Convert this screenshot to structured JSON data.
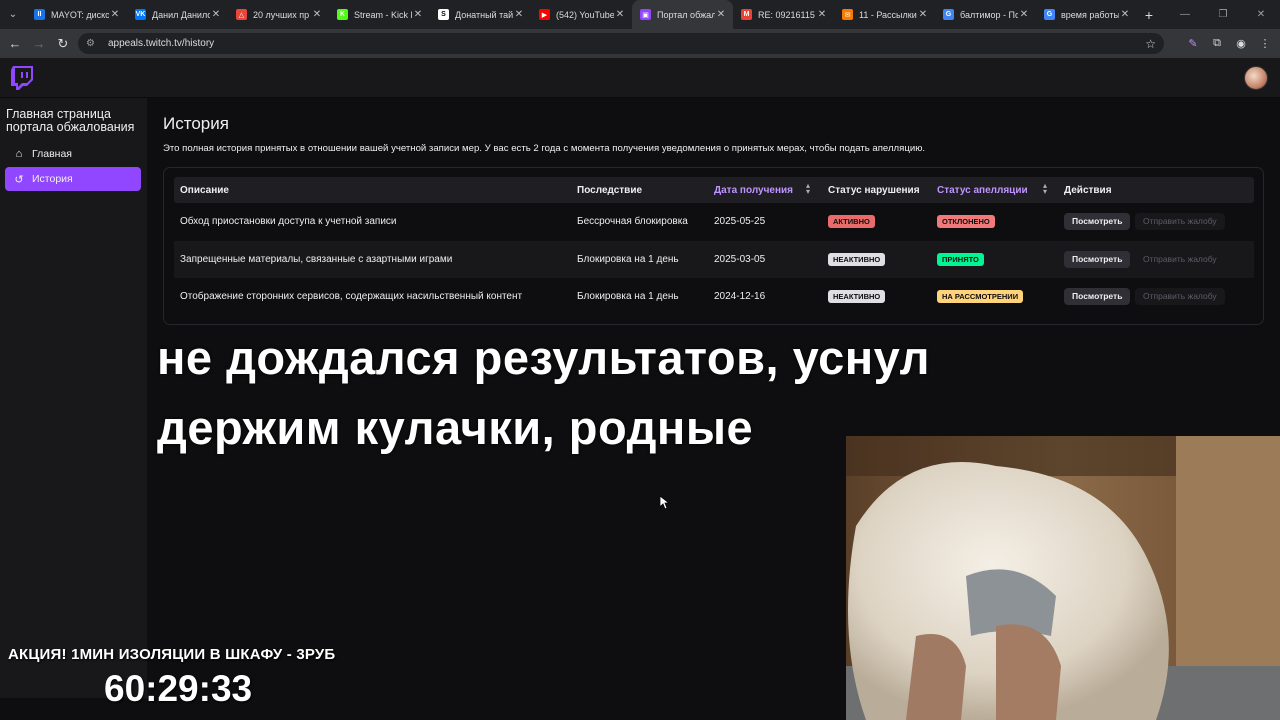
{
  "browser": {
    "tabs": [
      {
        "label": "MAYOT: дискор",
        "fav_color": "#1a73e8",
        "fav_text": "II",
        "active": false
      },
      {
        "label": "Данил Данилов",
        "fav_color": "#0077ff",
        "fav_text": "VK",
        "active": false
      },
      {
        "label": "20 лучших пр",
        "fav_color": "#e8453c",
        "fav_text": "△",
        "active": false
      },
      {
        "label": "Stream - Kick D",
        "fav_color": "#53fc18",
        "fav_text": "K",
        "active": false
      },
      {
        "label": "Донатный тай",
        "fav_color": "#ffffff",
        "fav_text": "S",
        "active": false
      },
      {
        "label": "(542) YouTube",
        "fav_color": "#ff0000",
        "fav_text": "▶",
        "active": false
      },
      {
        "label": "Портал обжал",
        "fav_color": "#9147ff",
        "fav_text": "▣",
        "active": true
      },
      {
        "label": "RE: 09216115",
        "fav_color": "#ea4335",
        "fav_text": "M",
        "active": false
      },
      {
        "label": "11 - Рассылки",
        "fav_color": "#f57c00",
        "fav_text": "✉",
        "active": false
      },
      {
        "label": "балтимор - По",
        "fav_color": "#4285f4",
        "fav_text": "G",
        "active": false
      },
      {
        "label": "время работы",
        "fav_color": "#4285f4",
        "fav_text": "G",
        "active": false
      }
    ],
    "url": "appeals.twitch.tv/history"
  },
  "sidebar": {
    "title": "Главная страница портала обжалования",
    "items": [
      {
        "label": "Главная",
        "active": false
      },
      {
        "label": "История",
        "active": true
      }
    ]
  },
  "main": {
    "title": "История",
    "description": "Это полная история принятых в отношении вашей учетной записи мер. У вас есть 2 года с момента получения уведомления о принятых мерах, чтобы подать апелляцию.",
    "table": {
      "headers": {
        "description": "Описание",
        "consequence": "Последствие",
        "date": "Дата получения",
        "violation_status": "Статус нарушения",
        "appeal_status": "Статус апелляции",
        "actions": "Действия"
      },
      "rows": [
        {
          "description": "Обход приостановки доступа к учетной записи",
          "consequence": "Бессрочная блокировка",
          "date": "2025-05-25",
          "violation_status": "АКТИВНО",
          "violation_color": "#eb6b6b",
          "appeal_status": "ОТКЛОНЕНО",
          "appeal_color": "#f27979",
          "view_label": "Посмотреть",
          "appeal_label": "Отправить жалобу"
        },
        {
          "description": "Запрещенные материалы, связанные с азартными играми",
          "consequence": "Блокировка на 1 день",
          "date": "2025-03-05",
          "violation_status": "НЕАКТИВНО",
          "violation_color": "#dedee3",
          "appeal_status": "ПРИНЯТО",
          "appeal_color": "#00f593",
          "view_label": "Посмотреть",
          "appeal_label": "Отправить жалобу"
        },
        {
          "description": "Отображение сторонних сервисов, содержащих насильственный контент",
          "consequence": "Блокировка на 1 день",
          "date": "2024-12-16",
          "violation_status": "НЕАКТИВНО",
          "violation_color": "#dedee3",
          "appeal_status": "НА РАССМОТРЕНИИ",
          "appeal_color": "#ffd37a",
          "view_label": "Посмотреть",
          "appeal_label": "Отправить жалобу"
        }
      ]
    }
  },
  "overlay": {
    "line1": "не дождался результатов, уснул",
    "line2": "держим кулачки, родные",
    "promo": "АКЦИЯ! 1МИН ИЗОЛЯЦИИ В ШКАФУ - 3РУБ",
    "timer": "60:29:33"
  },
  "colors": {
    "accent": "#9147ff",
    "sort_header": "#bf94ff"
  }
}
